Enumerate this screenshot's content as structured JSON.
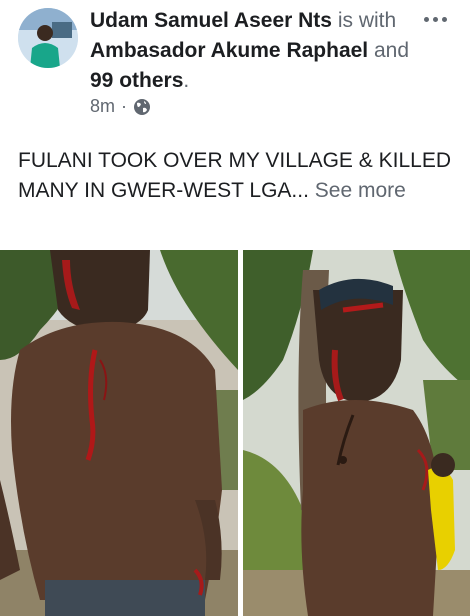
{
  "post": {
    "author": "Udam Samuel Aseer Nts",
    "with_text": "is with",
    "tagged": "Ambasador Akume Raphael",
    "and_text": "and",
    "others": "99 others",
    "period": ".",
    "time": "8m",
    "separator": "·",
    "privacy_icon": "globe-icon",
    "options_icon": "more-options-icon",
    "text": "FULANI TOOK OVER MY VILLAGE & KILLED MANY IN GWER-WEST LGA...",
    "see_more": "See more"
  },
  "colors": {
    "text_primary": "#1c1e21",
    "text_secondary": "#606770",
    "background": "#ffffff"
  }
}
